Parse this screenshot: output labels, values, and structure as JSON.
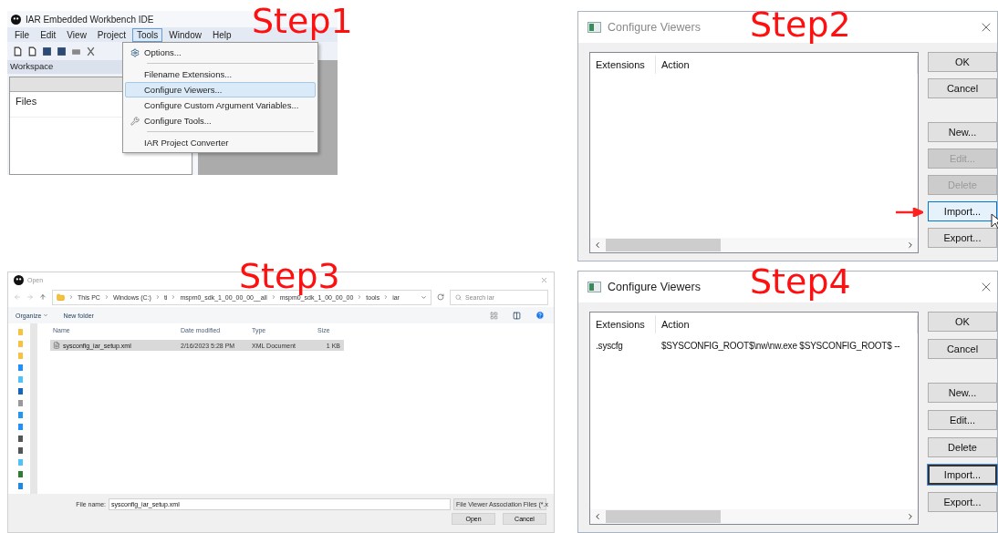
{
  "step1": {
    "label": "Step1",
    "window_title": "IAR Embedded Workbench IDE",
    "menu": [
      {
        "label": "File",
        "selected": false
      },
      {
        "label": "Edit",
        "selected": false
      },
      {
        "label": "View",
        "selected": false
      },
      {
        "label": "Project",
        "selected": false
      },
      {
        "label": "Tools",
        "selected": true
      },
      {
        "label": "Window",
        "selected": false
      },
      {
        "label": "Help",
        "selected": false
      }
    ],
    "dropdown": [
      {
        "kind": "icon-item",
        "label": "Options...",
        "selected": false
      },
      {
        "kind": "separator"
      },
      {
        "kind": "item",
        "label": "Filename Extensions...",
        "selected": false
      },
      {
        "kind": "item",
        "label": "Configure Viewers...",
        "selected": true
      },
      {
        "kind": "item",
        "label": "Configure Custom Argument Variables...",
        "selected": false
      },
      {
        "kind": "icon-item",
        "label": "Configure Tools...",
        "selected": false
      },
      {
        "kind": "separator"
      },
      {
        "kind": "item",
        "label": "IAR Project Converter",
        "selected": false
      }
    ],
    "workspace_label": "Workspace",
    "files_label": "Files"
  },
  "step2": {
    "label": "Step2",
    "title": "Configure Viewers",
    "active": false,
    "columns": [
      "Extensions",
      "Action"
    ],
    "button_groups": [
      [
        {
          "label": "OK",
          "disabled": false,
          "focused": false,
          "pointed": false
        },
        {
          "label": "Cancel",
          "disabled": false,
          "focused": false,
          "pointed": false
        }
      ],
      [
        {
          "label": "New...",
          "disabled": false,
          "focused": false,
          "pointed": false
        },
        {
          "label": "Edit...",
          "disabled": true,
          "focused": false,
          "pointed": false
        },
        {
          "label": "Delete",
          "disabled": true,
          "focused": false,
          "pointed": false
        },
        {
          "label": "Import...",
          "disabled": false,
          "focused": true,
          "pointed": true
        },
        {
          "label": "Export...",
          "disabled": false,
          "focused": false,
          "pointed": false
        }
      ]
    ]
  },
  "step3": {
    "label": "Step3",
    "title": "Open",
    "path": [
      "This PC",
      "Windows (C:)",
      "ti",
      "mspm0_sdk_1_00_00_00__all",
      "mspm0_sdk_1_00_00_00",
      "tools",
      "iar"
    ],
    "search": {
      "placeholder": "Search iar"
    },
    "toolbar": [
      "Organize",
      "New folder"
    ],
    "columns": [
      "Name",
      "Date modified",
      "Type",
      "Size"
    ],
    "rows": [
      {
        "name": "sysconfig_iar_setup.xml",
        "date": "2/16/2023 5:28 PM",
        "type": "XML Document",
        "size": "1 KB",
        "selected": true
      }
    ],
    "file_name_label": "File name:",
    "file_name": "sysconfig_iar_setup.xml",
    "filter": "File Viewer Association Files (*.x",
    "buttons": [
      "Open",
      "Cancel"
    ]
  },
  "step4": {
    "label": "Step4",
    "title": "Configure Viewers",
    "active": true,
    "columns": [
      "Extensions",
      "Action"
    ],
    "rows": [
      {
        "extension": ".syscfg",
        "action": "$SYSCONFIG_ROOT$\\nw\\nw.exe $SYSCONFIG_ROOT$ --"
      }
    ],
    "button_groups": [
      [
        {
          "label": "OK",
          "disabled": false,
          "focused": false,
          "pointed": false
        },
        {
          "label": "Cancel",
          "disabled": false,
          "focused": false,
          "pointed": false
        }
      ],
      [
        {
          "label": "New...",
          "disabled": false,
          "focused": false,
          "pointed": false
        },
        {
          "label": "Edit...",
          "disabled": false,
          "focused": false,
          "pointed": false
        },
        {
          "label": "Delete",
          "disabled": false,
          "focused": false,
          "pointed": false
        },
        {
          "label": "Import...",
          "disabled": false,
          "focused": true,
          "pointed": false
        },
        {
          "label": "Export...",
          "disabled": false,
          "focused": false,
          "pointed": false
        }
      ]
    ]
  }
}
